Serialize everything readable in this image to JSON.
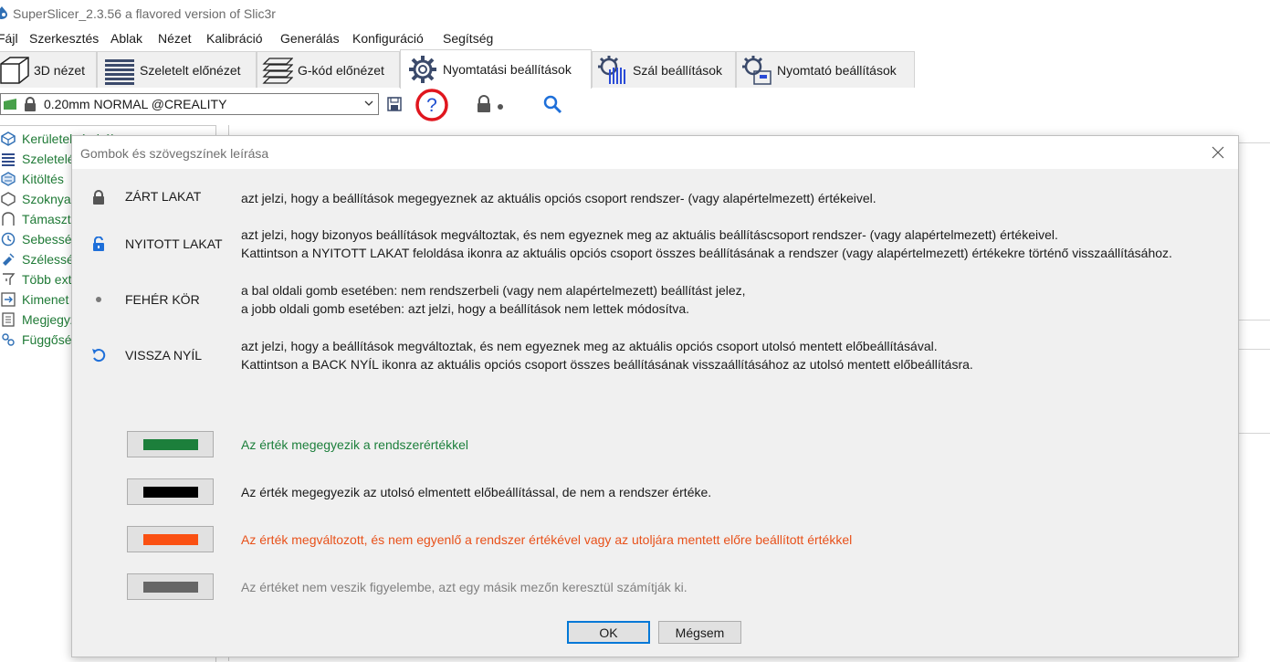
{
  "window": {
    "title": "SuperSlicer_2.3.56 a flavored version of Slic3r"
  },
  "menu": [
    "Fájl",
    "Szerkesztés",
    "Ablak",
    "Nézet",
    "Kalibráció",
    "Generálás",
    "Konfiguráció",
    "Segítség"
  ],
  "tabs": [
    {
      "label": "3D nézet",
      "icon": "cube-icon"
    },
    {
      "label": "Szeletelt előnézet",
      "icon": "layers-icon"
    },
    {
      "label": "G-kód előnézet",
      "icon": "gcode-layers-icon"
    },
    {
      "label": "Nyomtatási beállítások",
      "icon": "gear-icon"
    },
    {
      "label": "Szál beállítások",
      "icon": "filament-spool-icon"
    },
    {
      "label": "Nyomtató beállítások",
      "icon": "printer-settings-icon"
    }
  ],
  "preset": {
    "value": "0.20mm NORMAL @CREALITY"
  },
  "sidebar": {
    "items": [
      {
        "label": "Kerületek és héj"
      },
      {
        "label": "Szeletelés"
      },
      {
        "label": "Kitöltés"
      },
      {
        "label": "Szoknya és perem"
      },
      {
        "label": "Támasztóanyag"
      },
      {
        "label": "Sebesség"
      },
      {
        "label": "Szélesség és átfedés"
      },
      {
        "label": "Több extruder"
      },
      {
        "label": "Kimenet beállítások"
      },
      {
        "label": "Megjegyzések"
      },
      {
        "label": "Függőségek"
      }
    ]
  },
  "dialog": {
    "title": "Gombok és szövegszínek leírása",
    "rows": [
      {
        "label": "ZÁRT LAKAT",
        "icon": "lock-closed-icon",
        "lines": [
          "azt jelzi, hogy a beállítások megegyeznek az aktuális opciós csoport rendszer- (vagy alapértelmezett) értékeivel."
        ]
      },
      {
        "label": "NYITOTT LAKAT",
        "icon": "lock-open-icon",
        "lines": [
          "azt jelzi, hogy bizonyos beállítások megváltoztak, és nem egyeznek meg az aktuális beállításcsoport rendszer- (vagy alapértelmezett) értékeivel.",
          "Kattintson a NYITOTT LAKAT feloldása ikonra az aktuális opciós csoport összes beállításának a rendszer (vagy alapértelmezett) értékekre történő visszaállításához."
        ]
      },
      {
        "label": "FEHÉR KÖR",
        "icon": "white-dot-icon",
        "lines": [
          "a bal oldali gomb esetében: nem rendszerbeli (vagy nem alapértelmezett) beállítást jelez,",
          "a jobb oldali gomb esetében: azt jelzi, hogy a beállítások nem lettek módosítva."
        ]
      },
      {
        "label": "VISSZA NYÍL",
        "icon": "back-arrow-icon",
        "lines": [
          "azt jelzi, hogy a beállítások megváltoztak, és nem egyeznek meg az aktuális opciós csoport utolsó mentett előbeállításával.",
          "Kattintson a BACK NYÍL ikonra az aktuális opciós csoport összes beállításának visszaállításához az utolsó mentett előbeállításra."
        ]
      }
    ],
    "colors": [
      {
        "color": "#1c7f3b",
        "text": "Az érték megegyezik a rendszerértékkel"
      },
      {
        "color": "#000000",
        "text": "Az érték megegyezik az utolsó elmentett előbeállítással, de nem a rendszer értéke."
      },
      {
        "color": "#fa5012",
        "text": "Az érték megváltozott, és nem egyenlő a rendszer értékével vagy az utoljára mentett előre beállított értékkel"
      },
      {
        "color": "#666666",
        "text": "Az értéket nem veszik figyelembe, azt egy másik mezőn keresztül számítják ki."
      }
    ],
    "ok_label": "OK",
    "cancel_label": "Mégsem"
  },
  "accent": {
    "help_ring": "#e0161e",
    "link_blue": "#1e6fd9"
  }
}
